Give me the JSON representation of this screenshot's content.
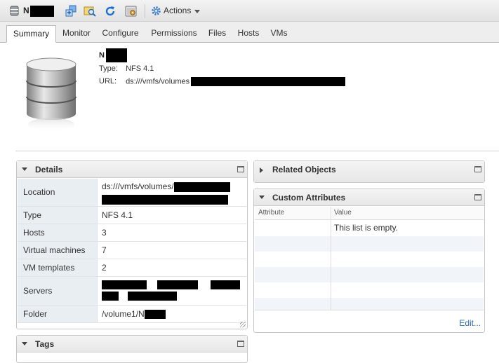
{
  "titlebar": {
    "name_prefix": "N",
    "actions_label": "Actions"
  },
  "tabs": [
    {
      "label": "Summary",
      "active": true
    },
    {
      "label": "Monitor"
    },
    {
      "label": "Configure"
    },
    {
      "label": "Permissions"
    },
    {
      "label": "Files"
    },
    {
      "label": "Hosts"
    },
    {
      "label": "VMs"
    }
  ],
  "header": {
    "name_prefix": "N",
    "type_label": "Type:",
    "type_value": "NFS 4.1",
    "url_label": "URL:",
    "url_value": "ds:///vmfs/volumes"
  },
  "details": {
    "title": "Details",
    "rows": [
      {
        "label": "Location",
        "value": "ds:///vmfs/volumes/"
      },
      {
        "label": "Type",
        "value": "NFS 4.1"
      },
      {
        "label": "Hosts",
        "value": "3"
      },
      {
        "label": "Virtual machines",
        "value": "7"
      },
      {
        "label": "VM templates",
        "value": "2"
      },
      {
        "label": "Servers",
        "value": ""
      },
      {
        "label": "Folder",
        "value": "/volume1/N"
      }
    ]
  },
  "tags": {
    "title": "Tags"
  },
  "related_objects": {
    "title": "Related Objects"
  },
  "custom_attributes": {
    "title": "Custom Attributes",
    "col_attribute": "Attribute",
    "col_value": "Value",
    "empty_text": "This list is empty.",
    "edit_label": "Edit..."
  },
  "icons": {
    "datastore": "datastore-icon",
    "toolbar": [
      "new-vm-icon",
      "browse-files-icon",
      "refresh-icon",
      "settings-icon",
      "gear-icon"
    ]
  },
  "colors": {
    "accent": "#2a6ebb",
    "label_bg": "#e9eef3"
  }
}
